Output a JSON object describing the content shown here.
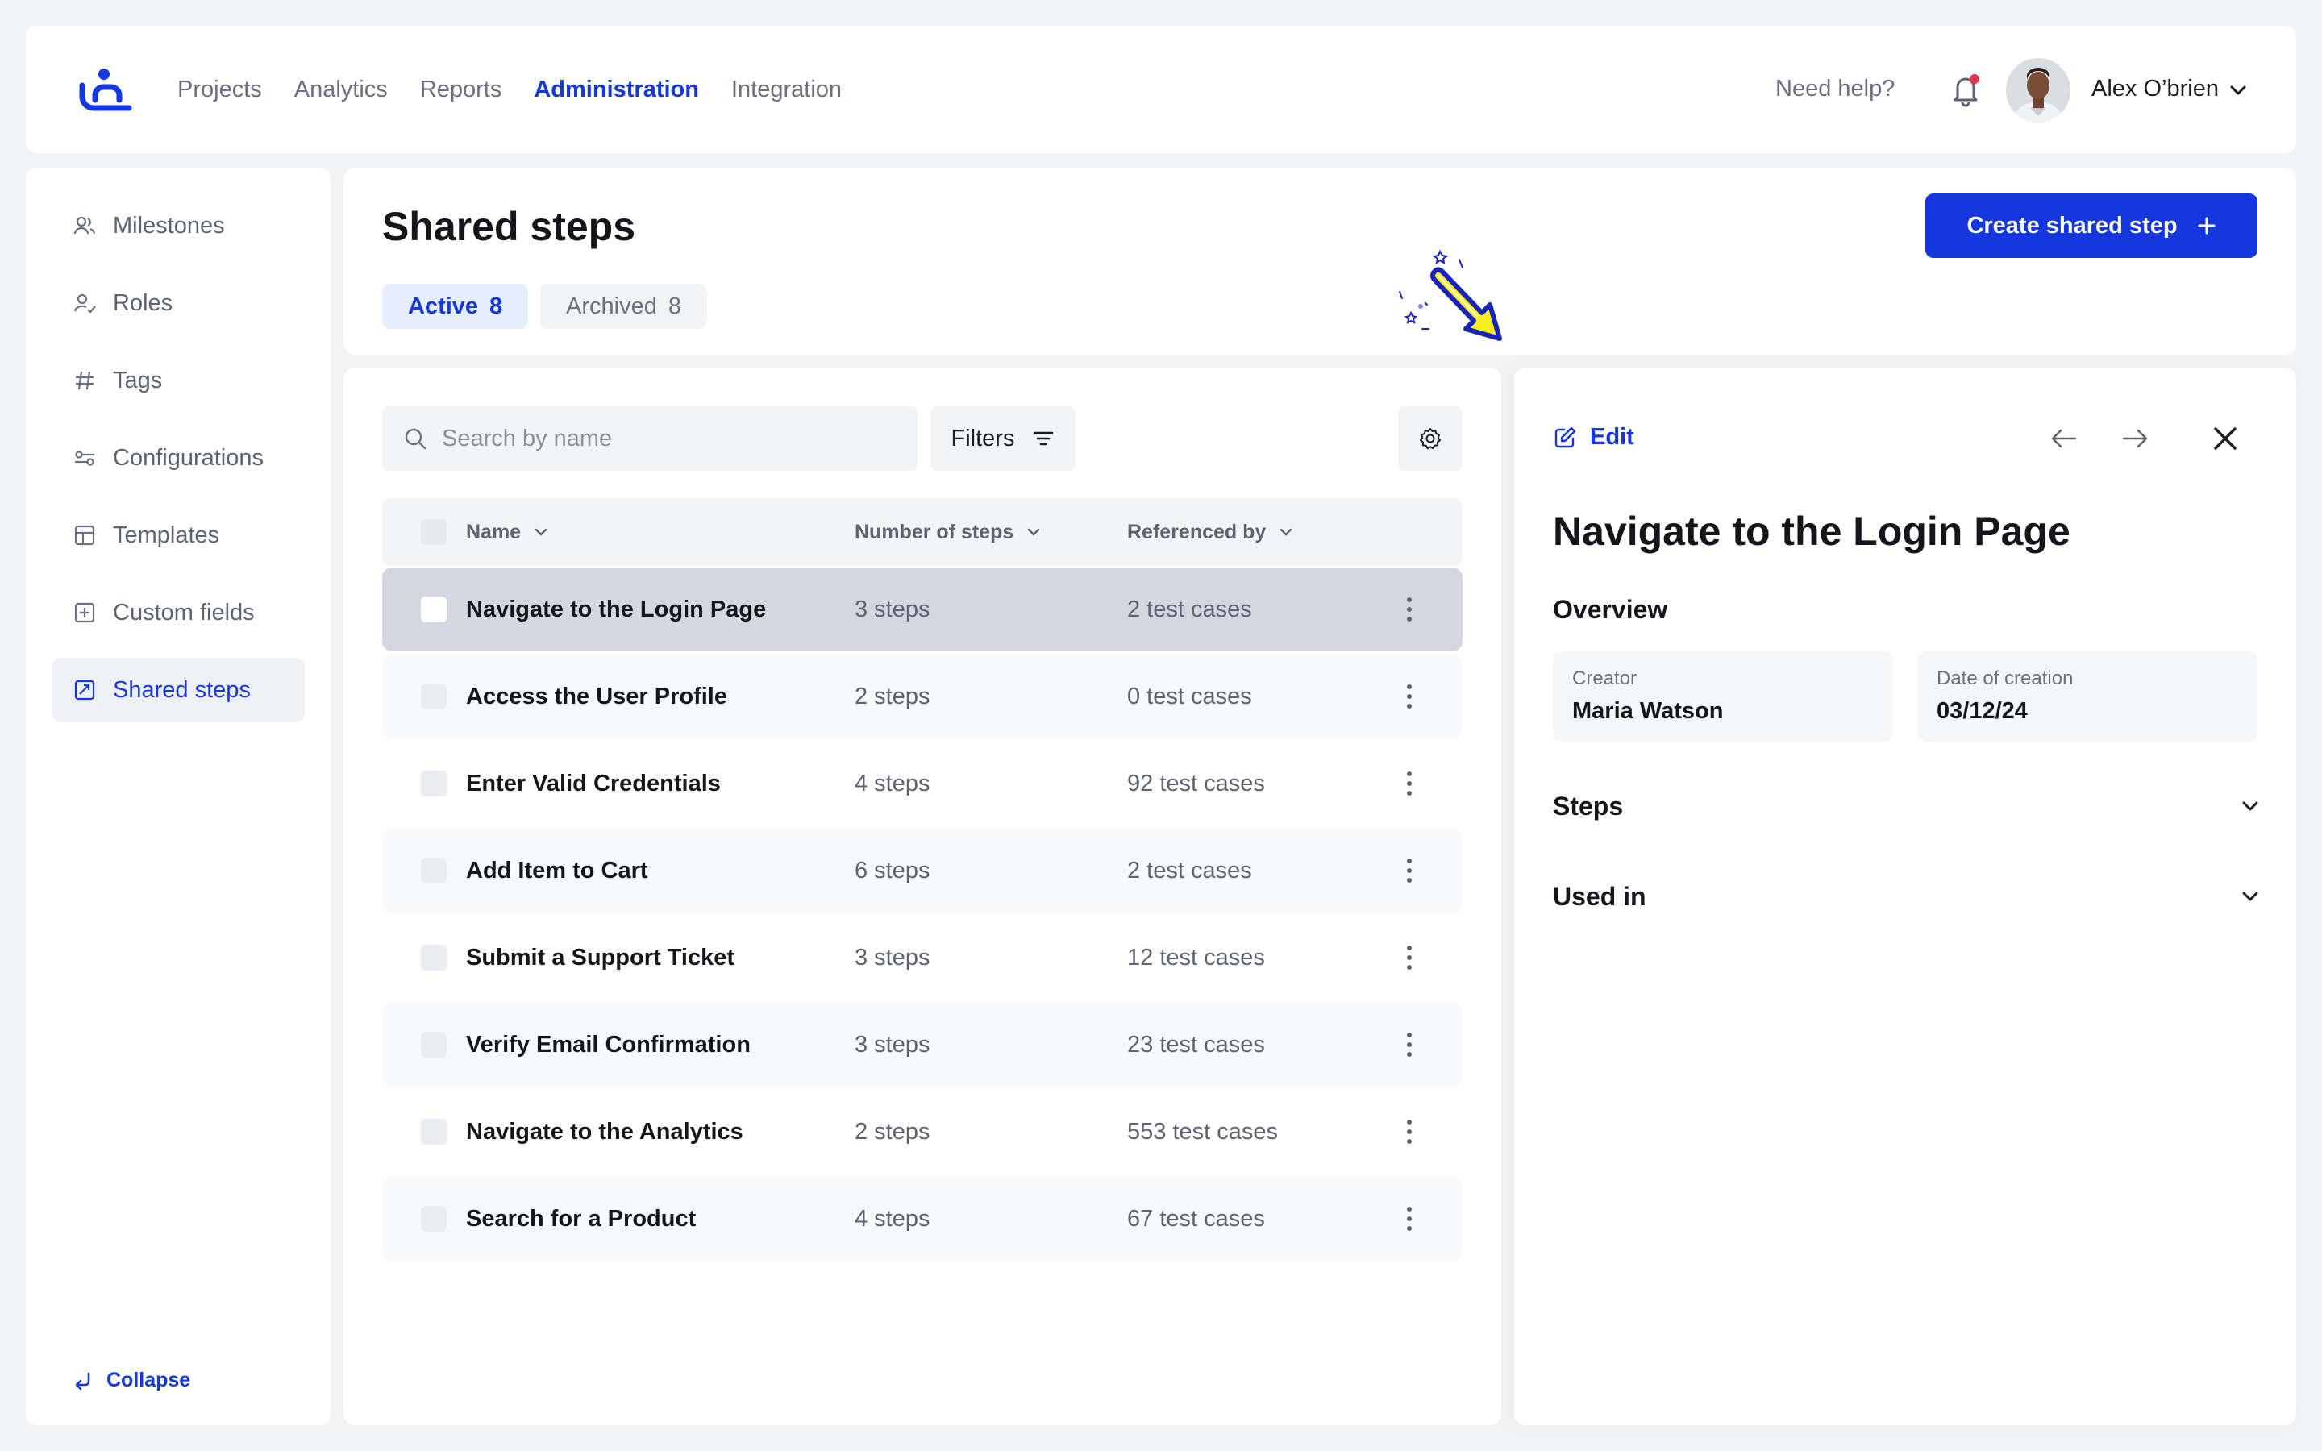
{
  "nav": {
    "items": [
      "Projects",
      "Analytics",
      "Reports",
      "Administration",
      "Integration"
    ],
    "active": "Administration",
    "help": "Need help?",
    "user": "Alex O’brien"
  },
  "sidebar": {
    "items": [
      {
        "label": "Milestones",
        "icon": "milestones-icon"
      },
      {
        "label": "Roles",
        "icon": "roles-icon"
      },
      {
        "label": "Tags",
        "icon": "hash-icon"
      },
      {
        "label": "Configurations",
        "icon": "configurations-icon"
      },
      {
        "label": "Templates",
        "icon": "templates-icon"
      },
      {
        "label": "Custom fields",
        "icon": "custom-fields-icon"
      },
      {
        "label": "Shared steps",
        "icon": "shared-steps-icon"
      }
    ],
    "active": "Shared steps",
    "collapse": "Collapse"
  },
  "header": {
    "title": "Shared steps",
    "tabs": [
      {
        "label": "Active",
        "count": "8"
      },
      {
        "label": "Archived",
        "count": "8"
      }
    ],
    "create_button": "Create shared step"
  },
  "list": {
    "search_placeholder": "Search by name",
    "filters_label": "Filters",
    "columns": [
      "Name",
      "Number of steps",
      "Referenced by"
    ],
    "rows": [
      {
        "name": "Navigate to the Login Page",
        "steps": "3 steps",
        "refs": "2 test cases",
        "selected": true
      },
      {
        "name": "Access the User Profile",
        "steps": "2 steps",
        "refs": "0 test cases"
      },
      {
        "name": "Enter Valid Credentials",
        "steps": "4 steps",
        "refs": "92 test cases"
      },
      {
        "name": "Add Item to Cart",
        "steps": "6 steps",
        "refs": "2 test cases"
      },
      {
        "name": "Submit a Support Ticket",
        "steps": "3 steps",
        "refs": "12 test cases"
      },
      {
        "name": "Verify Email Confirmation",
        "steps": "3 steps",
        "refs": "23 test cases"
      },
      {
        "name": "Navigate to the Analytics",
        "steps": "2 steps",
        "refs": "553 test cases"
      },
      {
        "name": "Search for a Product",
        "steps": "4 steps",
        "refs": "67 test cases"
      }
    ]
  },
  "detail": {
    "edit_label": "Edit",
    "title": "Navigate to the Login Page",
    "overview_label": "Overview",
    "creator_label": "Creator",
    "creator_value": "Maria Watson",
    "date_label": "Date of creation",
    "date_value": "03/12/24",
    "steps_label": "Steps",
    "used_in_label": "Used in"
  },
  "colors": {
    "accent": "#1437e0",
    "background": "#f2f3f5",
    "selected_row": "#d3d7e0",
    "notification_dot": "#e5334b",
    "pointer_arrow": "#f7ef1b"
  }
}
